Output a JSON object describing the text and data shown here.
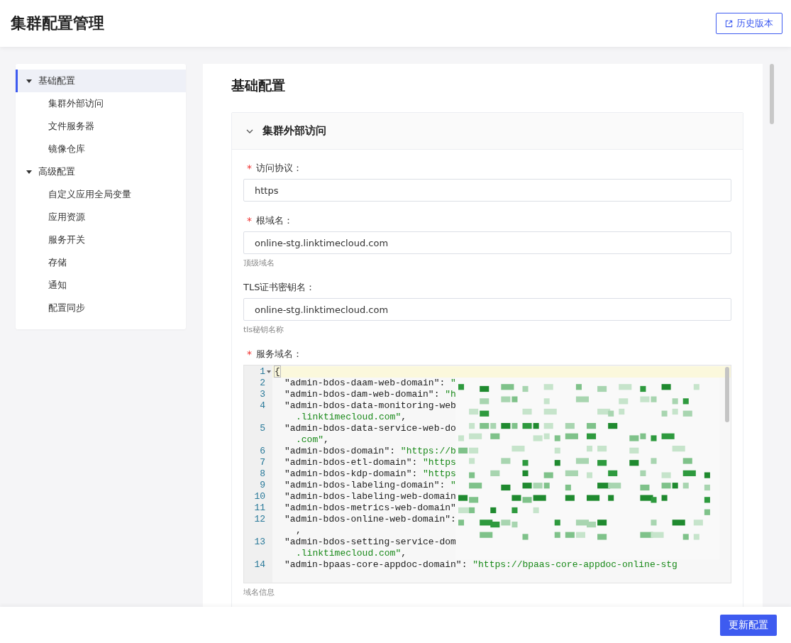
{
  "header": {
    "title": "集群配置管理",
    "history_button": "历史版本"
  },
  "sidebar": {
    "items": [
      {
        "label": "基础配置",
        "selected": true,
        "expanded": true,
        "children": [
          {
            "label": "集群外部访问",
            "selected": false
          },
          {
            "label": "文件服务器",
            "selected": false
          },
          {
            "label": "镜像仓库",
            "selected": false
          }
        ]
      },
      {
        "label": "高级配置",
        "selected": false,
        "expanded": true,
        "children": [
          {
            "label": "自定义应用全局变量",
            "selected": false
          },
          {
            "label": "应用资源",
            "selected": false
          },
          {
            "label": "服务开关",
            "selected": false
          },
          {
            "label": "存储",
            "selected": false
          },
          {
            "label": "通知",
            "selected": false
          },
          {
            "label": "配置同步",
            "selected": false
          }
        ]
      }
    ]
  },
  "main": {
    "title": "基础配置",
    "panel": {
      "title": "集群外部访问",
      "expanded": true,
      "fields": [
        {
          "kind": "input",
          "label": "访问协议：",
          "required_mark": "*",
          "value": "https"
        },
        {
          "kind": "input",
          "label": "根域名：",
          "required_mark": "*",
          "value": "online-stg.linktimecloud.com",
          "help": "顶级域名"
        },
        {
          "kind": "input",
          "label": "TLS证书密钥名：",
          "value": "online-stg.linktimecloud.com",
          "help": "tls秘钥名称"
        },
        {
          "kind": "code",
          "label": "服务域名：",
          "required_mark": "*",
          "help": "域名信息",
          "lines": [
            {
              "number": "1",
              "fold": true,
              "active": true,
              "key": "{"
            },
            {
              "number": "2",
              "key": "\"admin-bdos-daam-web-domain\"",
              "sep": ": ",
              "value": "\""
            },
            {
              "number": "3",
              "key": "\"admin-bdos-dam-web-domain\"",
              "sep": ": ",
              "value": "\"h"
            },
            {
              "number": "4",
              "key": "\"admin-bdos-data-monitoring-web",
              "wrap": {
                "value": ".linktimecloud.com\"",
                "sep": ","
              }
            },
            {
              "number": "5",
              "key": "\"admin-bdos-data-service-web-do",
              "wrap": {
                "value": ".com\"",
                "sep": ","
              }
            },
            {
              "number": "6",
              "key": "\"admin-bdos-domain\"",
              "sep": ": ",
              "value": "\"https://b"
            },
            {
              "number": "7",
              "key": "\"admin-bdos-etl-domain\"",
              "sep": ": ",
              "value": "\"https"
            },
            {
              "number": "8",
              "key": "\"admin-bdos-kdp-domain\"",
              "sep": ": ",
              "value": "\"https"
            },
            {
              "number": "9",
              "key": "\"admin-bdos-labeling-domain\"",
              "sep": ": ",
              "value": "\""
            },
            {
              "number": "10",
              "key": "\"admin-bdos-labeling-web-domain"
            },
            {
              "number": "11",
              "key": "\"admin-bdos-metrics-web-domain\""
            },
            {
              "number": "12",
              "key": "\"admin-bdos-online-web-domain\"",
              "sep": ":",
              "wrap": {
                "sep": ","
              }
            },
            {
              "number": "13",
              "key": "\"admin-bdos-setting-service-dom",
              "wrap": {
                "value": ".linktimecloud.com\"",
                "sep": ","
              }
            },
            {
              "number": "14",
              "key": "\"admin-bpaas-core-appdoc-domain\"",
              "sep": ": ",
              "value": "\"https://bpaas-core-appdoc-online-stg"
            }
          ]
        }
      ]
    }
  },
  "footer": {
    "submit_button": "更新配置"
  }
}
